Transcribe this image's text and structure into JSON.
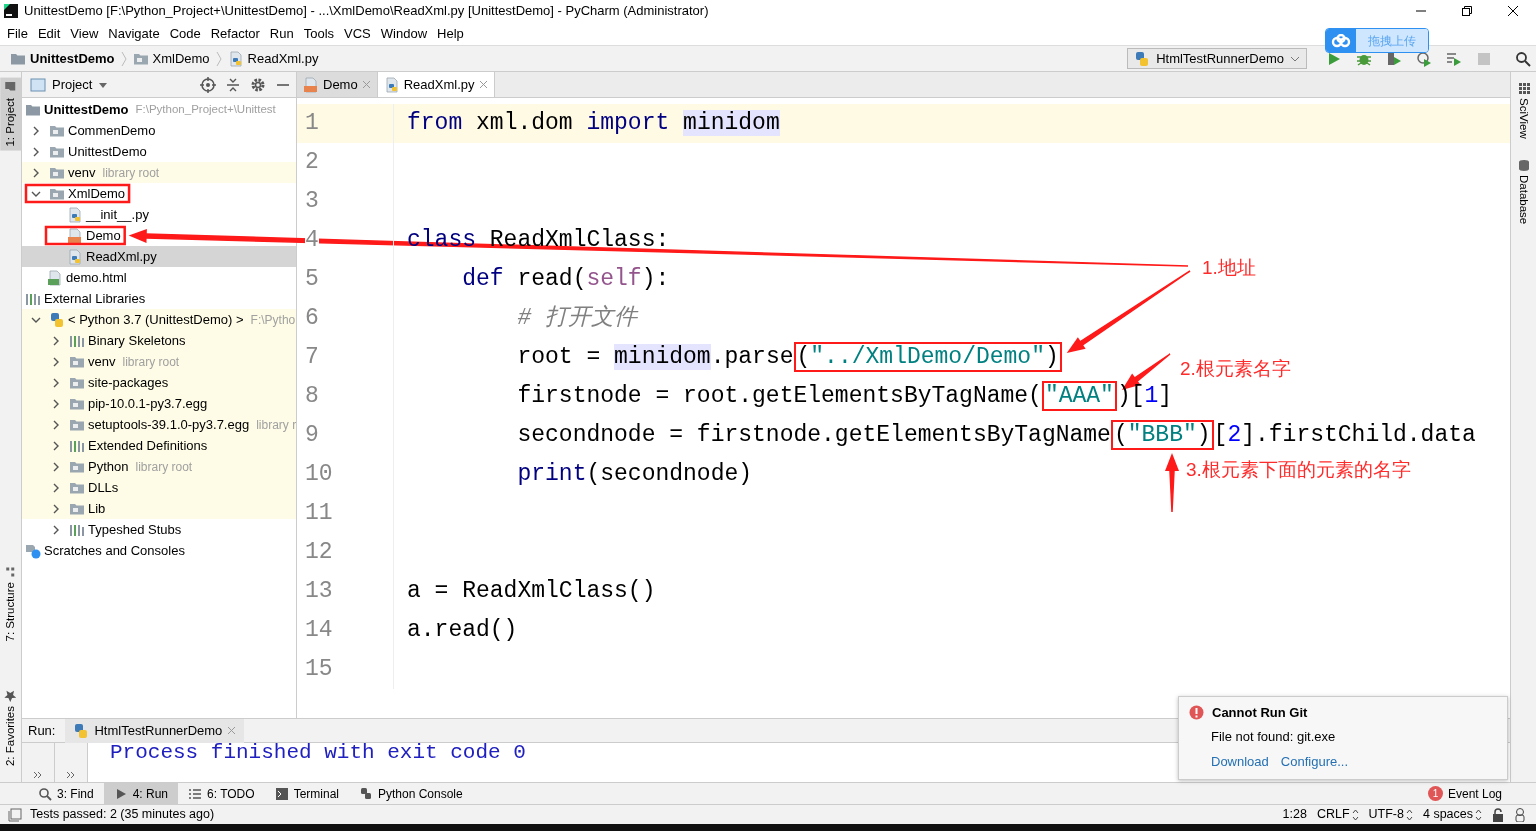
{
  "window": {
    "title": "UnittestDemo [F:\\Python_Project+\\UnittestDemo] - ...\\XmlDemo\\ReadXml.py [UnittestDemo] - PyCharm (Administrator)"
  },
  "menu": [
    "File",
    "Edit",
    "View",
    "Navigate",
    "Code",
    "Refactor",
    "Run",
    "Tools",
    "VCS",
    "Window",
    "Help"
  ],
  "breadcrumb": [
    {
      "label": "UnittestDemo",
      "kind": "project"
    },
    {
      "label": "XmlDemo",
      "kind": "folder"
    },
    {
      "label": "ReadXml.py",
      "kind": "py"
    }
  ],
  "run_config": "HtmlTestRunnerDemo",
  "upload_button": "拖拽上传",
  "left_stripe": [
    {
      "label": "1: Project",
      "kind": "project",
      "selected": true
    },
    {
      "label": "7: Structure",
      "kind": "structure",
      "selected": false
    },
    {
      "label": "2: Favorites",
      "kind": "favorites",
      "selected": false
    }
  ],
  "right_stripe": [
    "SciView",
    "Database"
  ],
  "project_panel": {
    "title": "Project",
    "tree": [
      {
        "label": "UnittestDemo",
        "hint": "F:\\Python_Project+\\Unittest",
        "kind": "project",
        "selected": false,
        "children": [
          {
            "label": "CommenDemo",
            "kind": "folder",
            "expanded": false,
            "selected": false
          },
          {
            "label": "UnittestDemo",
            "kind": "folder",
            "expanded": false,
            "selected": false
          },
          {
            "label": "venv",
            "hint": "library root",
            "kind": "folder",
            "expanded": false,
            "selected": false,
            "library": true
          },
          {
            "label": "XmlDemo",
            "kind": "folder",
            "expanded": true,
            "selected": false,
            "boxed": true,
            "children": [
              {
                "label": "__init__.py",
                "kind": "py",
                "selected": false
              },
              {
                "label": "Demo",
                "kind": "xml",
                "selected": false,
                "boxed": true
              },
              {
                "label": "ReadXml.py",
                "kind": "py",
                "selected": true
              }
            ]
          },
          {
            "label": "demo.html",
            "kind": "html",
            "selected": false
          }
        ]
      },
      {
        "label": "External Libraries",
        "kind": "library",
        "selected": false,
        "children": [
          {
            "label": "< Python 3.7 (UnittestDemo) >",
            "hint": "F:\\Pytho",
            "kind": "python",
            "expanded": true,
            "selected": false,
            "library": true,
            "children": [
              {
                "label": "Binary Skeletons",
                "kind": "library",
                "expanded": false,
                "selected": false,
                "library": true
              },
              {
                "label": "venv",
                "hint": "library root",
                "kind": "folder",
                "expanded": false,
                "selected": false,
                "library": true
              },
              {
                "label": "site-packages",
                "kind": "folder",
                "expanded": false,
                "selected": false,
                "library": true
              },
              {
                "label": "pip-10.0.1-py3.7.egg",
                "kind": "folder",
                "expanded": false,
                "selected": false,
                "library": true
              },
              {
                "label": "setuptools-39.1.0-py3.7.egg",
                "hint": "library r",
                "kind": "folder",
                "expanded": false,
                "selected": false,
                "library": true
              },
              {
                "label": "Extended Definitions",
                "kind": "library",
                "expanded": false,
                "selected": false,
                "library": true
              },
              {
                "label": "Python",
                "hint": "library root",
                "kind": "folder",
                "expanded": false,
                "selected": false,
                "library": true
              },
              {
                "label": "DLLs",
                "kind": "folder",
                "expanded": false,
                "selected": false,
                "library": true
              },
              {
                "label": "Lib",
                "kind": "folder",
                "expanded": false,
                "selected": false,
                "library": true
              },
              {
                "label": "Typeshed Stubs",
                "kind": "library",
                "expanded": false,
                "selected": false
              }
            ]
          }
        ]
      },
      {
        "label": "Scratches and Consoles",
        "kind": "scratch",
        "selected": false
      }
    ]
  },
  "editor": {
    "tabs": [
      {
        "label": "Demo",
        "kind": "xml",
        "selected": false
      },
      {
        "label": "ReadXml.py",
        "kind": "py",
        "selected": true
      }
    ],
    "lines": [
      {
        "number": "1",
        "current": true,
        "tokens": [
          {
            "text": "from",
            "kind": "keyword"
          },
          {
            "text": " xml.dom ",
            "kind": "plain"
          },
          {
            "text": "import ",
            "kind": "keyword"
          },
          {
            "text": "minidom",
            "kind": "plain",
            "usage": true
          }
        ]
      },
      {
        "number": "2",
        "current": false
      },
      {
        "number": "3",
        "current": false
      },
      {
        "number": "4",
        "current": false,
        "tokens": [
          {
            "text": "class",
            "kind": "keyword"
          },
          {
            "text": " ReadXmlClass:",
            "kind": "plain"
          }
        ]
      },
      {
        "number": "5",
        "current": false,
        "tokens": [
          {
            "text": "    def",
            "kind": "keyword"
          },
          {
            "text": " read(",
            "kind": "plain"
          },
          {
            "text": "self",
            "kind": "self"
          },
          {
            "text": "):",
            "kind": "plain"
          }
        ]
      },
      {
        "number": "6",
        "current": false,
        "tokens": [
          {
            "text": "        # 打开文件",
            "kind": "comment"
          }
        ]
      },
      {
        "number": "7",
        "current": false,
        "tokens": [
          {
            "text": "        root = ",
            "kind": "plain"
          },
          {
            "text": "minidom",
            "kind": "plain",
            "usage": true
          },
          {
            "text": ".parse",
            "kind": "plain"
          },
          {
            "text": "(",
            "kind": "plain",
            "boxed": true
          },
          {
            "text": "\"../XmlDemo/Demo\"",
            "kind": "string",
            "boxed": true
          },
          {
            "text": ")",
            "kind": "plain",
            "boxed": true
          }
        ]
      },
      {
        "number": "8",
        "current": false,
        "tokens": [
          {
            "text": "        firstnode = root.getElementsByTagName(",
            "kind": "plain"
          },
          {
            "text": "\"AAA\"",
            "kind": "string",
            "boxed": true
          },
          {
            "text": ")[",
            "kind": "plain"
          },
          {
            "text": "1",
            "kind": "number"
          },
          {
            "text": "]",
            "kind": "plain"
          }
        ]
      },
      {
        "number": "9",
        "current": false,
        "tokens": [
          {
            "text": "        secondnode = firstnode.getElementsByTagName",
            "kind": "plain"
          },
          {
            "text": "(",
            "kind": "plain",
            "boxed": true
          },
          {
            "text": "\"BBB\"",
            "kind": "string",
            "boxed": true
          },
          {
            "text": ")",
            "kind": "plain",
            "boxed": true
          },
          {
            "text": "[",
            "kind": "plain"
          },
          {
            "text": "2",
            "kind": "number"
          },
          {
            "text": "].firstChild.data",
            "kind": "plain"
          }
        ]
      },
      {
        "number": "10",
        "current": false,
        "tokens": [
          {
            "text": "        print",
            "kind": "builtin"
          },
          {
            "text": "(secondnode)",
            "kind": "plain"
          }
        ]
      },
      {
        "number": "11",
        "current": false
      },
      {
        "number": "12",
        "current": false
      },
      {
        "number": "13",
        "current": false,
        "tokens": [
          {
            "text": "a = ReadXmlClass()",
            "kind": "plain"
          }
        ]
      },
      {
        "number": "14",
        "current": false,
        "tokens": [
          {
            "text": "a.read()",
            "kind": "plain"
          }
        ]
      },
      {
        "number": "15",
        "current": false
      }
    ]
  },
  "annotations": [
    "1.地址",
    "2.根元素名字",
    "3.根元素下面的元素的名字"
  ],
  "run_panel": {
    "label": "Run:",
    "tab": "HtmlTestRunnerDemo",
    "output": "Process finished with exit code 0"
  },
  "tool_windows": [
    {
      "label": "3: Find",
      "kind": "find",
      "selected": false
    },
    {
      "label": "4: Run",
      "kind": "run",
      "selected": true
    },
    {
      "label": "6: TODO",
      "kind": "todo",
      "selected": false
    },
    {
      "label": "Terminal",
      "kind": "terminal",
      "selected": false
    },
    {
      "label": "Python Console",
      "kind": "console",
      "selected": false
    }
  ],
  "event_log": {
    "label": "Event Log",
    "count": "1"
  },
  "notification": {
    "title": "Cannot Run Git",
    "message": "File not found: git.exe",
    "links": [
      "Download",
      "Configure..."
    ]
  },
  "status_bar": {
    "message": "Tests passed: 2 (35 minutes ago)",
    "position": "1:28",
    "line_separator": "CRLF",
    "encoding": "UTF-8",
    "indent": "4 spaces"
  }
}
